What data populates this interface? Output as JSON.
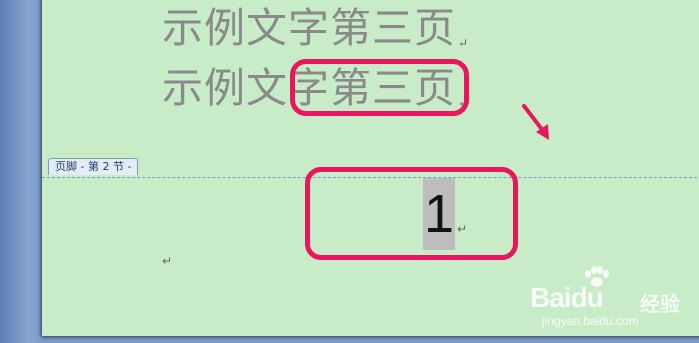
{
  "document": {
    "body_lines": [
      "示例文字第三页",
      "示例文字第三页"
    ],
    "paragraph_mark": "↵",
    "footer": {
      "tag_label": "页脚 - 第 2 节 -",
      "page_number": "1"
    }
  },
  "annotations": {
    "highlight_color": "#e8175d"
  },
  "watermark": {
    "logo": "Baidu",
    "product": "经验",
    "url": "jingyan.baidu.com"
  }
}
